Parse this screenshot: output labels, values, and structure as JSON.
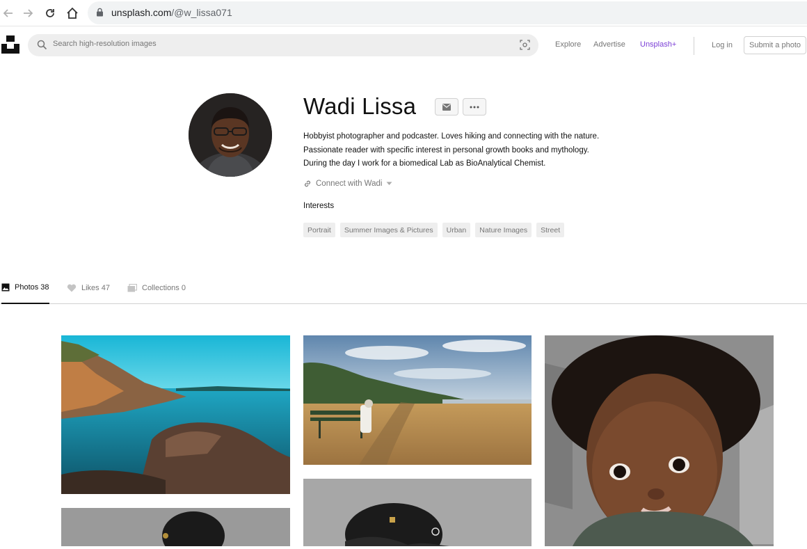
{
  "browser": {
    "url_domain": "unsplash.com",
    "url_path": "/@w_lissa071"
  },
  "header": {
    "search_placeholder": "Search high-resolution images",
    "nav": {
      "explore": "Explore",
      "advertise": "Advertise",
      "unsplash_plus": "Unsplash+",
      "login": "Log in",
      "submit": "Submit a photo"
    }
  },
  "profile": {
    "name": "Wadi Lissa",
    "bio_lines": [
      "Hobbyist photographer and podcaster. Loves hiking and connecting with the nature.",
      "Passionate reader with specific interest in personal growth books and mythology.",
      "During the day I work for a biomedical Lab as BioAnalytical Chemist."
    ],
    "connect_label": "Connect with Wadi",
    "interests_title": "Interests",
    "interests": [
      "Portrait",
      "Summer Images & Pictures",
      "Urban",
      "Nature Images",
      "Street"
    ]
  },
  "tabs": [
    {
      "label": "Photos 38",
      "icon": "image-icon",
      "active": true
    },
    {
      "label": "Likes 47",
      "icon": "heart-icon",
      "active": false
    },
    {
      "label": "Collections 0",
      "icon": "collections-icon",
      "active": false
    }
  ],
  "photos": [
    {
      "subject": "rocky coastline with turquoise sea"
    },
    {
      "subject": "person on bench in dry meadow by the sea"
    },
    {
      "subject": "portrait of a young child with curly hair"
    },
    {
      "subject": "braided hair portrait"
    },
    {
      "subject": "braided hair close-up"
    }
  ],
  "colors": {
    "accent_plus": "#7b3fd6",
    "text_muted": "#767676",
    "tag_bg": "#eeeeee"
  }
}
